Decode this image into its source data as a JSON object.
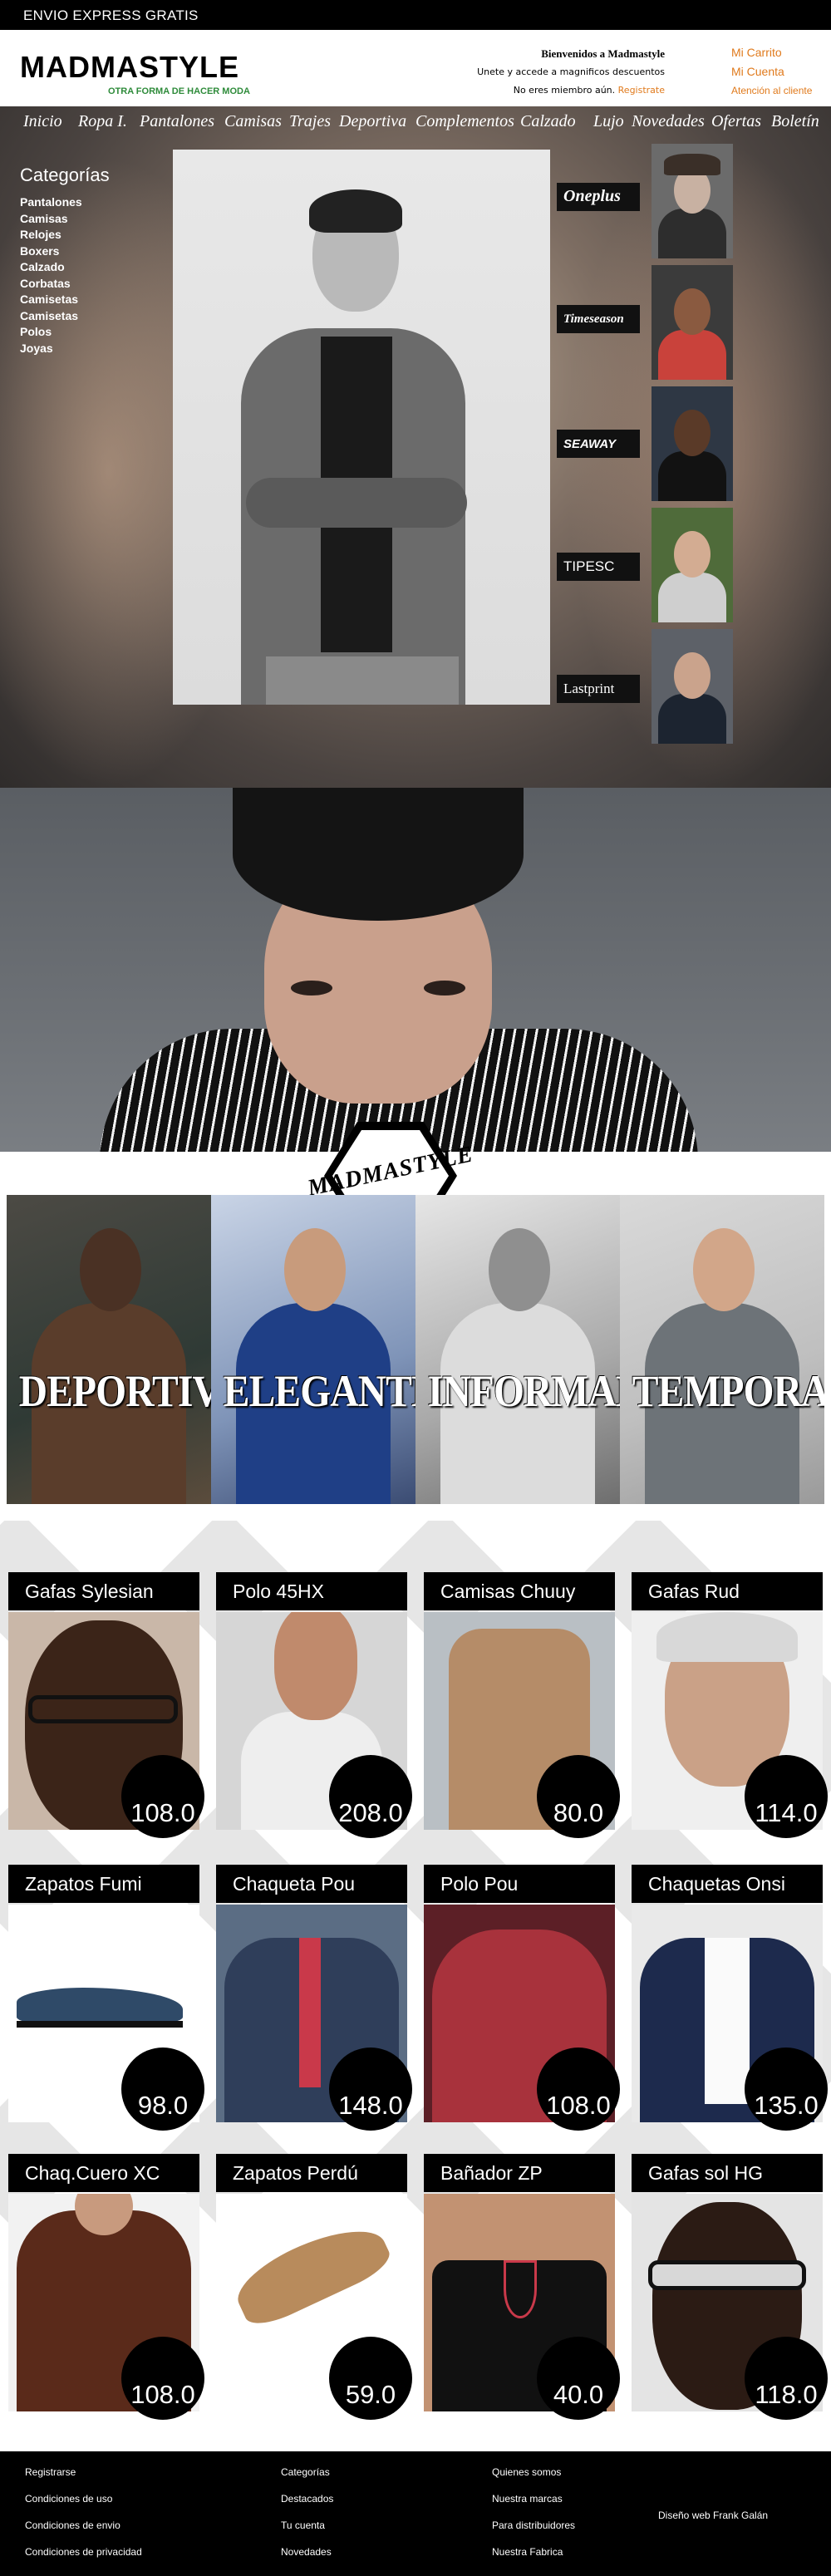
{
  "topbar": {
    "text": "ENVIO EXPRESS GRATIS"
  },
  "header": {
    "logo": "MADMASTYLE",
    "tagline": "OTRA FORMA DE HACER MODA",
    "welcome_title": "Bienvenidos a Madmastyle",
    "welcome_sub": "Unete y accede a magnificos descuentos",
    "not_member": "No eres miembro aún.",
    "register": "Registrate",
    "links": [
      "Mi Carrito",
      "Mi Cuenta",
      "Atención al cliente"
    ]
  },
  "nav": [
    "Inicio",
    "Ropa I.",
    "Pantalones",
    "Camisas",
    "Trajes",
    "Deportiva",
    "Complementos",
    "Calzado",
    "Lujo",
    "Novedades",
    "Ofertas",
    "Boletín"
  ],
  "sidebar": {
    "title": "Categorías",
    "items": [
      "Pantalones",
      "Camisas",
      "Relojes",
      "Boxers",
      "Calzado",
      "Corbatas",
      "Camisetas",
      "Camisetas",
      "Polos",
      "Joyas"
    ]
  },
  "brands": [
    "Oneplus",
    "Timeseason",
    "SEAWAY",
    "TIPESC",
    "Lastprint"
  ],
  "stamp": "MADMASTYLE",
  "styles": [
    "DEPORTIVA",
    "ELEGANTE",
    "INFORMAL",
    "TEMPORADA"
  ],
  "products": [
    {
      "name": "Gafas Sylesian",
      "price": "108.0"
    },
    {
      "name": "Polo 45HX",
      "price": "208.0"
    },
    {
      "name": "Camisas Chuuy",
      "price": "80.0"
    },
    {
      "name": "Gafas Rud",
      "price": "114.0"
    },
    {
      "name": "Zapatos Fumi",
      "price": "98.0"
    },
    {
      "name": "Chaqueta Pou",
      "price": "148.0"
    },
    {
      "name": "Polo Pou",
      "price": "108.0"
    },
    {
      "name": "Chaquetas Onsi",
      "price": "135.0"
    },
    {
      "name": "Chaq.Cuero XC",
      "price": "108.0"
    },
    {
      "name": "Zapatos Perdú",
      "price": "59.0"
    },
    {
      "name": "Bañador ZP",
      "price": "40.0"
    },
    {
      "name": "Gafas sol HG",
      "price": "118.0"
    }
  ],
  "footer": {
    "col1": [
      "Registrarse",
      "Condiciones de uso",
      "Condiciones de envio",
      "Condiciones de privacidad"
    ],
    "col2": [
      "Categorías",
      "Destacados",
      "Tu cuenta",
      "Novedades"
    ],
    "col3": [
      "Quienes somos",
      "Nuestra marcas",
      "Para distribuidores",
      "Nuestra Fabrica"
    ],
    "credit": "Diseño web Frank Galán"
  }
}
